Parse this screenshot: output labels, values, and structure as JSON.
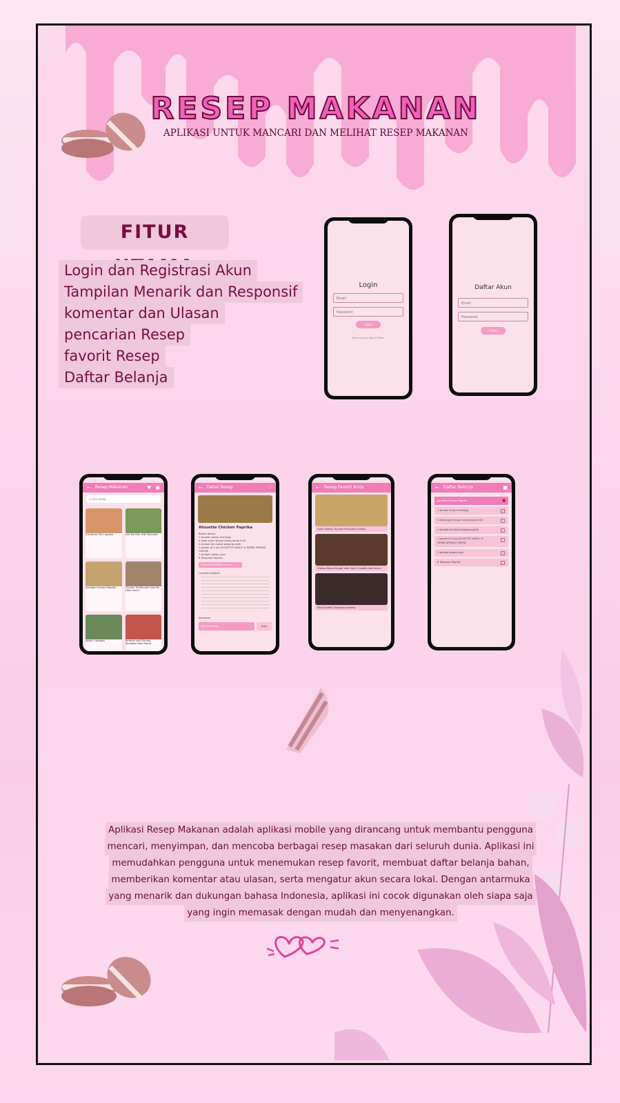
{
  "title": "RESEP MAKANAN",
  "subtitle": "APLIKASI UNTUK MANCARI DAN MELIHAT RESEP MAKANAN",
  "features_heading": "FITUR UTAMA",
  "features": [
    "Login dan Registrasi Akun",
    "Tampilan Menarik dan Responsif",
    "komentar dan Ulasan",
    "pencarian Resep",
    "favorit Resep",
    "Daftar Belanja"
  ],
  "login_screen": {
    "title": "Login",
    "email_placeholder": "Email",
    "password_placeholder": "Password",
    "button": "Login",
    "link": "Belum punya akun? Daftar"
  },
  "register_screen": {
    "title": "Daftar Akun",
    "email_placeholder": "Email",
    "password_placeholder": "Password",
    "button": "Daftar"
  },
  "home_screen": {
    "appbar": "Resep Makanan",
    "search_placeholder": "Cari resep...",
    "recipes": [
      "Christmas Pie Cupcake",
      "Lola My Pear with Pancetta",
      "Alouette Chicken Paprika",
      "Chicken Tortilla with Low Fat Kittie Sauce",
      "Apple Cupcakes",
      "Tortellini with Shrimp, Tomatoes Basil Sauce"
    ]
  },
  "detail_screen": {
    "appbar": "Detail Resep",
    "recipe_title": "Alouette Chicken Paprika",
    "ingredients_heading": "Bahan-bahan:",
    "ingredients": [
      "1 sendok makan mentega",
      "4 dada ayam tanpa tulang tanpa kulit",
      "2 sendok teh bubuk bawang putih",
      "1 wadah (6.5 oz) ALOUETTE GARLIC & HERBS SPREAD CHEESE",
      "1 sendok makan susu",
      "8 Teaspoon Paprika"
    ],
    "add_button": "Tambahkan Daftar Belanja",
    "steps_heading": "Langkah-langkah:",
    "comment_heading": "Komentar",
    "comment_placeholder": "Tulis komentar...",
    "send_button": "Kirim"
  },
  "favorites_screen": {
    "appbar": "Resep Favorit Anda",
    "items": [
      "Goat Cheese, Fig and Prosciutto Crostini",
      "Cheesy Bacon Burger with Spicy Chipotle Aioli Sauce",
      "Mint-Dusted Chocolate pudding"
    ]
  },
  "shopping_screen": {
    "appbar": "Daftar Belanja",
    "header": "Alouette Chicken Paprika",
    "items": [
      "1 sendok makan mentega",
      "4 dada ayam tanpa tulang tanpa kulit",
      "2 sendok teh bubuk bawang putih",
      "1 wadah (6.5 oz) ALOUETTE GARLIC & HERBS SPREAD CHEESE",
      "1 sendok makan susu",
      "8 Teaspoon Paprika"
    ]
  },
  "description": [
    "Aplikasi Resep Makanan adalah aplikasi mobile yang dirancang untuk membantu pengguna",
    "mencari, menyimpan, dan mencoba berbagai resep masakan dari seluruh dunia. Aplikasi ini",
    "memudahkan pengguna untuk menemukan resep favorit, membuat daftar belanja bahan,",
    "memberikan komentar atau ulasan, serta mengatur akun secara lokal. Dengan antarmuka",
    "yang menarik dan dukungan bahasa Indonesia, aplikasi ini cocok digunakan oleh siapa saja",
    "yang ingin memasak dengan mudah dan menyenangkan."
  ],
  "colors": {
    "accent": "#f060b8",
    "dark_text": "#7a0c42",
    "appbar": "#f07cb8",
    "pill": "#efc9db"
  }
}
